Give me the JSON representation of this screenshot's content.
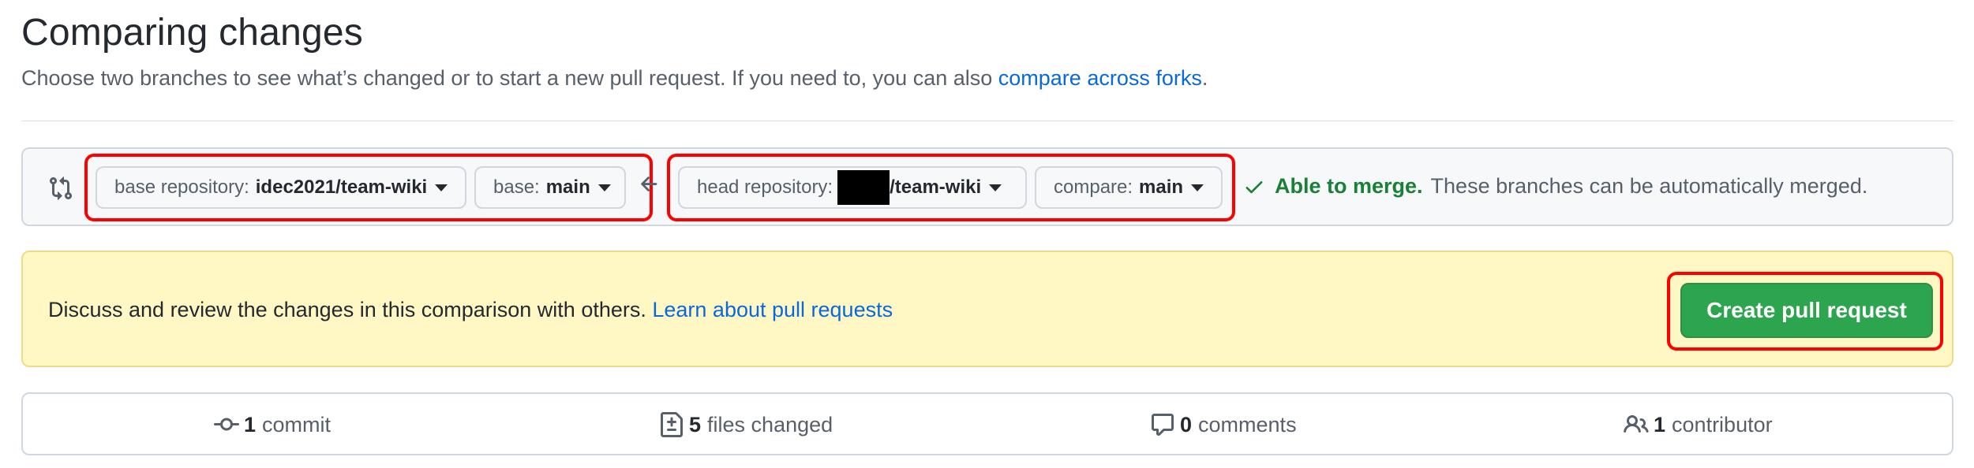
{
  "header": {
    "title": "Comparing changes",
    "subtitle": "Choose two branches to see what’s changed or to start a new pull request. If you need to, you can also ",
    "subtitle_link": "compare across forks",
    "subtitle_end": "."
  },
  "compare": {
    "base_repo_label": "base repository:",
    "base_repo_value": "idec2021/team-wiki",
    "base_label": "base:",
    "base_value": "main",
    "head_repo_label": "head repository:",
    "head_repo_value": "/team-wiki",
    "compare_label": "compare:",
    "compare_value": "main",
    "merge_ok": "Able to merge.",
    "merge_msg": "These branches can be automatically merged."
  },
  "discuss": {
    "text": "Discuss and review the changes in this comparison with others. ",
    "link": "Learn about pull requests",
    "button": "Create pull request"
  },
  "stats": {
    "commits_count": "1",
    "commits_label": "commit",
    "files_count": "5",
    "files_label": "files changed",
    "comments_count": "0",
    "comments_label": "comments",
    "contributors_count": "1",
    "contributors_label": "contributor"
  },
  "colors": {
    "link": "#0969da",
    "success": "#1a7f37",
    "button": "#2da44e",
    "highlight": "#ff0000",
    "flash_bg": "#fff8c5"
  },
  "icons": [
    "git-compare-icon",
    "arrow-left-icon",
    "check-icon",
    "git-commit-icon",
    "file-diff-icon",
    "comment-icon",
    "people-icon",
    "triangle-down-icon"
  ]
}
